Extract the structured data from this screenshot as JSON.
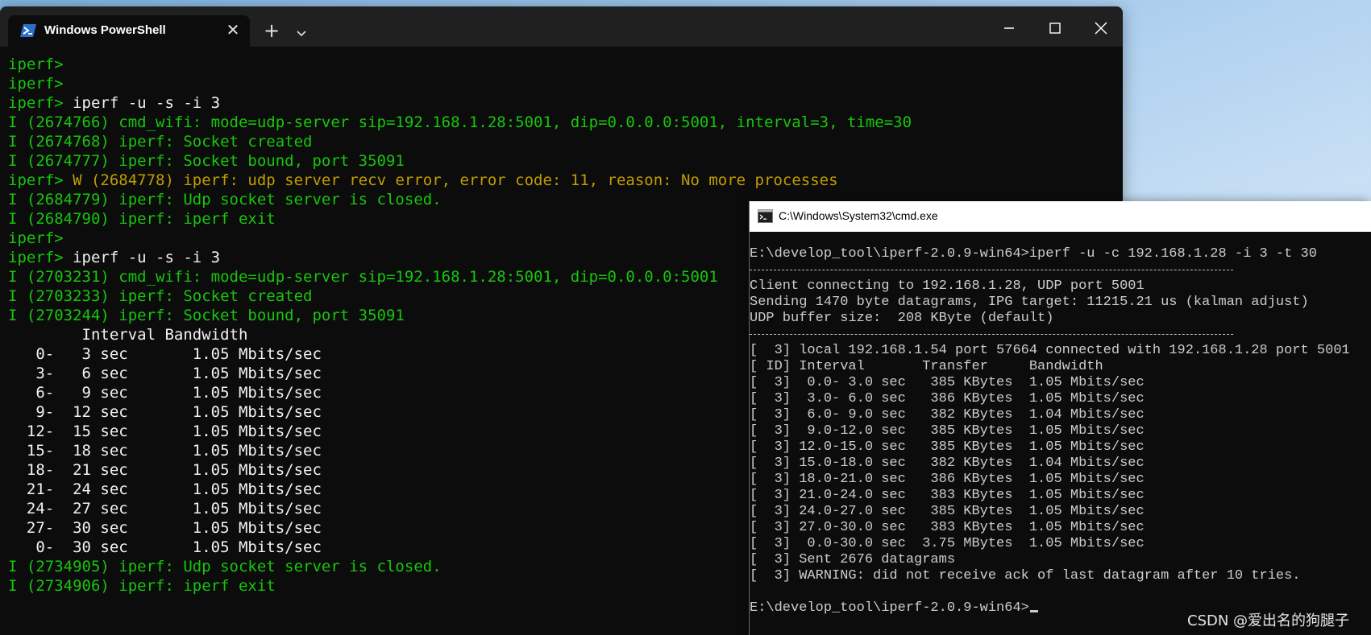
{
  "powershell": {
    "tab_title": "Windows PowerShell",
    "icons": {
      "tab": "powershell-icon",
      "close_tab": "close-icon",
      "new_tab": "plus-icon",
      "dropdown": "chevron-down-icon",
      "minimize": "minimize-icon",
      "maximize": "maximize-icon",
      "close": "close-icon"
    },
    "colors": {
      "background": "#0c0c0c",
      "titlebar": "#202020",
      "green": "#16c60c",
      "yellow": "#c19c00",
      "white": "#f2f2f2"
    },
    "lines": [
      {
        "prompt": "iperf>",
        "text": "",
        "style": "plain"
      },
      {
        "prompt": "iperf>",
        "text": "",
        "style": "plain"
      },
      {
        "prompt": "iperf> ",
        "text": "iperf -u -s -i 3",
        "style": "cmd"
      },
      {
        "prompt": "",
        "text": "I (2674766) cmd_wifi: mode=udp-server sip=192.168.1.28:5001, dip=0.0.0.0:5001, interval=3, time=30",
        "style": "info"
      },
      {
        "prompt": "",
        "text": "I (2674768) iperf: Socket created",
        "style": "info"
      },
      {
        "prompt": "",
        "text": "I (2674777) iperf: Socket bound, port 35091",
        "style": "info"
      },
      {
        "prompt": "iperf> ",
        "text": "W (2684778) iperf: udp server recv error, error code: 11, reason: No more processes",
        "style": "warn"
      },
      {
        "prompt": "",
        "text": "I (2684779) iperf: Udp socket server is closed.",
        "style": "info"
      },
      {
        "prompt": "",
        "text": "I (2684790) iperf: iperf exit",
        "style": "info"
      },
      {
        "prompt": "iperf>",
        "text": "",
        "style": "plain"
      },
      {
        "prompt": "iperf> ",
        "text": "iperf -u -s -i 3",
        "style": "cmd"
      },
      {
        "prompt": "",
        "text": "I (2703231) cmd_wifi: mode=udp-server sip=192.168.1.28:5001, dip=0.0.0.0:5001",
        "style": "info"
      },
      {
        "prompt": "",
        "text": "I (2703233) iperf: Socket created",
        "style": "info"
      },
      {
        "prompt": "",
        "text": "I (2703244) iperf: Socket bound, port 35091",
        "style": "info"
      },
      {
        "prompt": "",
        "text": "        Interval Bandwidth",
        "style": "plain"
      },
      {
        "prompt": "",
        "text": "   0-   3 sec       1.05 Mbits/sec",
        "style": "plain"
      },
      {
        "prompt": "",
        "text": "   3-   6 sec       1.05 Mbits/sec",
        "style": "plain"
      },
      {
        "prompt": "",
        "text": "   6-   9 sec       1.05 Mbits/sec",
        "style": "plain"
      },
      {
        "prompt": "",
        "text": "   9-  12 sec       1.05 Mbits/sec",
        "style": "plain"
      },
      {
        "prompt": "",
        "text": "  12-  15 sec       1.05 Mbits/sec",
        "style": "plain"
      },
      {
        "prompt": "",
        "text": "  15-  18 sec       1.05 Mbits/sec",
        "style": "plain"
      },
      {
        "prompt": "",
        "text": "  18-  21 sec       1.05 Mbits/sec",
        "style": "plain"
      },
      {
        "prompt": "",
        "text": "  21-  24 sec       1.05 Mbits/sec",
        "style": "plain"
      },
      {
        "prompt": "",
        "text": "  24-  27 sec       1.05 Mbits/sec",
        "style": "plain"
      },
      {
        "prompt": "",
        "text": "  27-  30 sec       1.05 Mbits/sec",
        "style": "plain"
      },
      {
        "prompt": "",
        "text": "   0-  30 sec       1.05 Mbits/sec",
        "style": "plain"
      },
      {
        "prompt": "",
        "text": "I (2734905) iperf: Udp socket server is closed.",
        "style": "info"
      },
      {
        "prompt": "",
        "text": "I (2734906) iperf: iperf exit",
        "style": "info"
      }
    ]
  },
  "cmd": {
    "title": "C:\\Windows\\System32\\cmd.exe",
    "icons": {
      "window": "console-icon"
    },
    "colors": {
      "background": "#0c0c0c",
      "titlebar": "#ffffff",
      "text": "#cccccc"
    },
    "lines": [
      {
        "kind": "text",
        "text": "E:\\develop_tool\\iperf-2.0.9-win64>iperf -u -c 192.168.1.28 -i 3 -t 30"
      },
      {
        "kind": "separator",
        "text": ""
      },
      {
        "kind": "text",
        "text": "Client connecting to 192.168.1.28, UDP port 5001"
      },
      {
        "kind": "text",
        "text": "Sending 1470 byte datagrams, IPG target: 11215.21 us (kalman adjust)"
      },
      {
        "kind": "text",
        "text": "UDP buffer size:  208 KByte (default)"
      },
      {
        "kind": "separator",
        "text": ""
      },
      {
        "kind": "text",
        "text": "[  3] local 192.168.1.54 port 57664 connected with 192.168.1.28 port 5001"
      },
      {
        "kind": "text",
        "text": "[ ID] Interval       Transfer     Bandwidth"
      },
      {
        "kind": "text",
        "text": "[  3]  0.0- 3.0 sec   385 KBytes  1.05 Mbits/sec"
      },
      {
        "kind": "text",
        "text": "[  3]  3.0- 6.0 sec   386 KBytes  1.05 Mbits/sec"
      },
      {
        "kind": "text",
        "text": "[  3]  6.0- 9.0 sec   382 KBytes  1.04 Mbits/sec"
      },
      {
        "kind": "text",
        "text": "[  3]  9.0-12.0 sec   385 KBytes  1.05 Mbits/sec"
      },
      {
        "kind": "text",
        "text": "[  3] 12.0-15.0 sec   385 KBytes  1.05 Mbits/sec"
      },
      {
        "kind": "text",
        "text": "[  3] 15.0-18.0 sec   382 KBytes  1.04 Mbits/sec"
      },
      {
        "kind": "text",
        "text": "[  3] 18.0-21.0 sec   386 KBytes  1.05 Mbits/sec"
      },
      {
        "kind": "text",
        "text": "[  3] 21.0-24.0 sec   383 KBytes  1.05 Mbits/sec"
      },
      {
        "kind": "text",
        "text": "[  3] 24.0-27.0 sec   385 KBytes  1.05 Mbits/sec"
      },
      {
        "kind": "text",
        "text": "[  3] 27.0-30.0 sec   383 KBytes  1.05 Mbits/sec"
      },
      {
        "kind": "text",
        "text": "[  3]  0.0-30.0 sec  3.75 MBytes  1.05 Mbits/sec"
      },
      {
        "kind": "text",
        "text": "[  3] Sent 2676 datagrams"
      },
      {
        "kind": "text",
        "text": "[  3] WARNING: did not receive ack of last datagram after 10 tries."
      },
      {
        "kind": "blank",
        "text": ""
      },
      {
        "kind": "prompt",
        "text": "E:\\develop_tool\\iperf-2.0.9-win64>"
      }
    ]
  },
  "watermark": "CSDN @爱出名的狗腿子"
}
